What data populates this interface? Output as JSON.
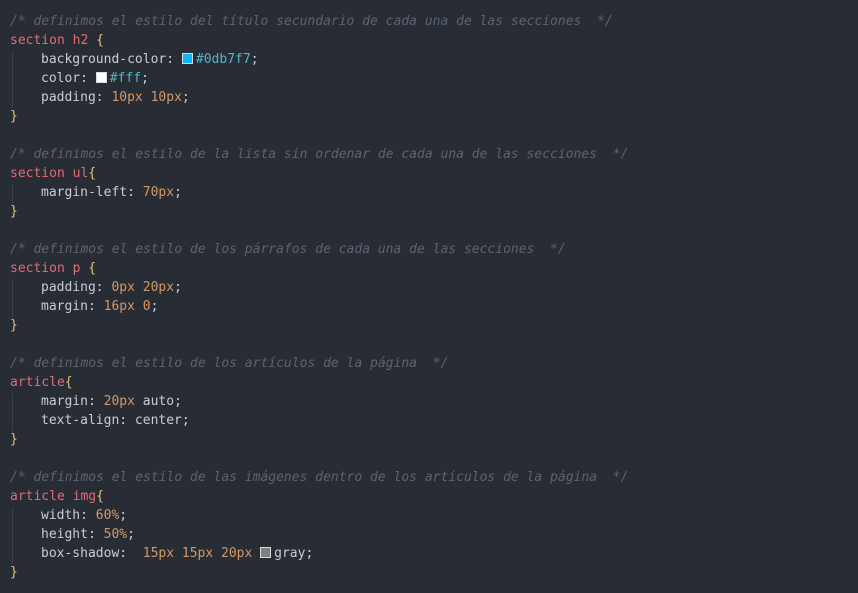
{
  "colors": {
    "background": "#282c34",
    "comment": "#5c6370",
    "selector": "#e06c75",
    "brace": "#e5c07b",
    "number": "#d19a66",
    "hex": "#56b6c2",
    "swatch_0db7f7": "#0db7f7",
    "swatch_fff": "#ffffff",
    "swatch_gray": "#808080"
  },
  "rules": [
    {
      "comment": "/* definimos el estilo del título secundario de cada una de las secciones  */",
      "selector": "section h2",
      "open": " {",
      "close": "}",
      "decls": [
        {
          "prop": "background-color:",
          "value": "#0db7f7",
          "swatch": "#0db7f7",
          "end": ";"
        },
        {
          "prop": "color:",
          "value": "#fff",
          "swatch": "#ffffff",
          "end": ";"
        },
        {
          "prop": "padding:",
          "value": "10px 10px",
          "end": ";"
        }
      ]
    },
    {
      "comment": "/* definimos el estilo de la lista sin ordenar de cada una de las secciones  */",
      "selector": "section ul",
      "open": "{",
      "close": "}",
      "decls": [
        {
          "prop": "margin-left:",
          "value": "70px",
          "end": ";"
        }
      ]
    },
    {
      "comment": "/* definimos el estilo de los párrafos de cada una de las secciones  */",
      "selector": "section p",
      "open": " {",
      "close": "}",
      "decls": [
        {
          "prop": "padding:",
          "value": "0px 20px",
          "end": ";"
        },
        {
          "prop": "margin:",
          "value": "16px 0",
          "end": ";"
        }
      ]
    },
    {
      "comment": "/* definimos el estilo de los artículos de la página  */",
      "selector": "article",
      "open": "{",
      "close": "}",
      "decls": [
        {
          "prop": "margin:",
          "value": "20px",
          "rest": " auto",
          "end": ";"
        },
        {
          "prop": "text-align:",
          "value": "",
          "rest": " center",
          "end": ";"
        }
      ]
    },
    {
      "comment": "/* definimos el estilo de las imágenes dentro de los artículos de la página  */",
      "selector": "article img",
      "open": "{",
      "close": "}",
      "decls": [
        {
          "prop": "width:",
          "value": "60%",
          "end": ";"
        },
        {
          "prop": "height:",
          "value": "50%",
          "end": ";"
        },
        {
          "prop": "box-shadow:",
          "value": " 15px 15px 20px",
          "swatch": "#808080",
          "rest": "gray",
          "end": ";"
        }
      ]
    }
  ]
}
